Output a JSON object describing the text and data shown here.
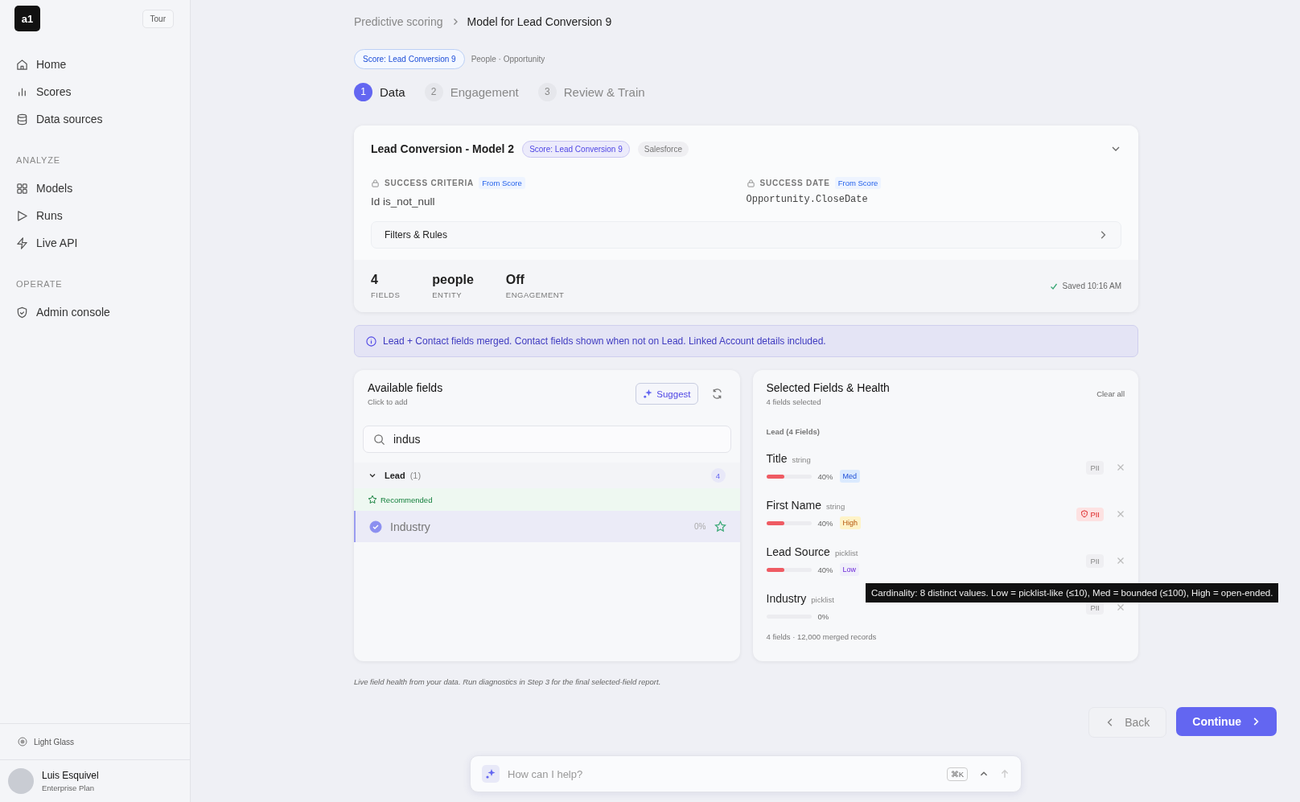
{
  "sidebar": {
    "logo": "a1",
    "tour": "Tour",
    "sections": [
      {
        "items": [
          {
            "label": "Home"
          },
          {
            "label": "Scores"
          },
          {
            "label": "Data sources"
          }
        ]
      },
      {
        "heading": "ANALYZE",
        "items": [
          {
            "label": "Models"
          },
          {
            "label": "Runs"
          },
          {
            "label": "Live API"
          }
        ]
      },
      {
        "heading": "OPERATE",
        "items": [
          {
            "label": "Admin console"
          }
        ]
      }
    ],
    "theme": "Light Glass",
    "user": {
      "name": "Luis Esquivel",
      "plan": "Enterprise Plan"
    }
  },
  "breadcrumb": [
    "Predictive scoring",
    "Model for Lead Conversion 9"
  ],
  "score_chip": "Score: Lead Conversion 9",
  "score_context": "People · Opportunity",
  "steps": [
    {
      "number": "1",
      "label": "Data",
      "selected": true
    },
    {
      "number": "2",
      "label": "Engagement",
      "selected": false
    },
    {
      "number": "3",
      "label": "Review & Train",
      "selected": false
    }
  ],
  "model_card": {
    "title": "Lead Conversion - Model 2",
    "score_tag": "Score: Lead Conversion 9",
    "source_tag": "Salesforce",
    "criteria": [
      {
        "label": "SUCCESS CRITERIA",
        "tag": "From Score",
        "value": "Id is_not_null",
        "kind": "text"
      },
      {
        "label": "SUCCESS DATE",
        "tag": "From Score",
        "value": "Opportunity.CloseDate",
        "kind": "code"
      }
    ],
    "filters": "Filters & Rules",
    "stats": [
      {
        "value": "4",
        "label": "FIELDS"
      },
      {
        "value": "people",
        "label": "ENTITY"
      },
      {
        "value": "Off",
        "label": "ENGAGEMENT"
      }
    ],
    "saved": "Saved 10:16 AM"
  },
  "info": "Lead + Contact fields merged. Contact fields shown when not on Lead. Linked Account details included.",
  "available": {
    "title": "Available fields",
    "subtitle": "Click to add",
    "suggest": "Suggest",
    "search": {
      "value": "indus"
    },
    "group": {
      "name": "Lead",
      "count": "(1)",
      "badge": "4",
      "expanded": true
    },
    "section": "Recommended",
    "items": [
      {
        "name": "Industry",
        "reading": "0%",
        "selected": true
      }
    ]
  },
  "selected": {
    "title": "Selected Fields & Health",
    "subtitle": "4 fields selected",
    "clear": "Clear all",
    "group": "Lead (4 Fields)",
    "fields": [
      {
        "name": "Title",
        "type": "string",
        "level": 0.4,
        "reading": "40%",
        "cardinality": {
          "label": "Med",
          "kind": "med"
        },
        "pii": {
          "label": "PII",
          "flagged": false
        }
      },
      {
        "name": "First Name",
        "type": "string",
        "level": 0.4,
        "reading": "40%",
        "cardinality": {
          "label": "High",
          "kind": "high"
        },
        "pii": {
          "label": "PII",
          "flagged": true
        }
      },
      {
        "name": "Lead Source",
        "type": "picklist",
        "level": 0.4,
        "reading": "40%",
        "cardinality": {
          "label": "Low",
          "kind": "low"
        },
        "pii": {
          "label": "PII",
          "flagged": false
        }
      },
      {
        "name": "Industry",
        "type": "picklist",
        "level": 0,
        "reading": "0%",
        "pii": {
          "label": "PII",
          "flagged": false
        }
      }
    ],
    "footer": "4 fields · 12,000 merged records"
  },
  "tooltip": "Cardinality: 8 distinct values. Low = picklist-like (≤10), Med = bounded (≤100), High = open-ended.",
  "footnote": "Live field health from your data. Run diagnostics in Step 3 for the final selected-field report.",
  "back": "Back",
  "continue": "Continue",
  "assistant": {
    "placeholder": "How can I help?",
    "shortcut": "⌘K"
  }
}
